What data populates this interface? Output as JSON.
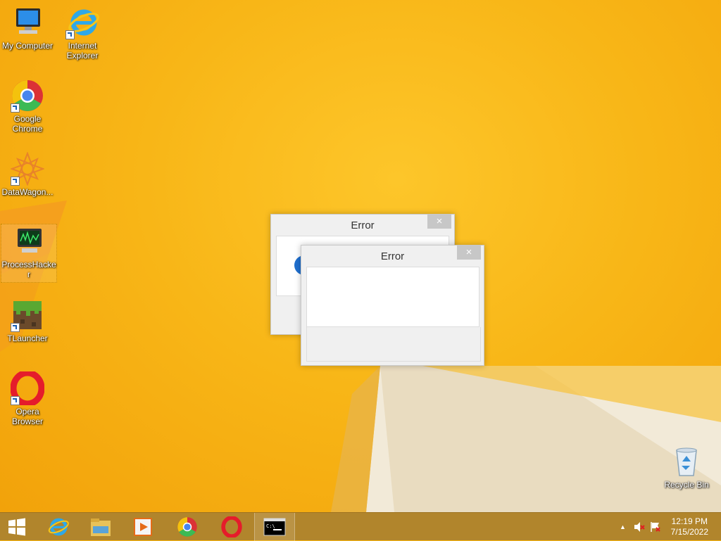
{
  "desktop": {
    "icons": [
      {
        "label": "My Computer",
        "icon": "computer-icon"
      },
      {
        "label": "Internet Explorer",
        "icon": "internet-explorer-icon"
      },
      {
        "label": "Google Chrome",
        "icon": "chrome-icon"
      },
      {
        "label": "DataWagon...",
        "icon": "datawagon-icon"
      },
      {
        "label": "ProcessHacker",
        "icon": "process-hacker-icon"
      },
      {
        "label": "TLauncher",
        "icon": "tlauncher-icon"
      },
      {
        "label": "Opera Browser",
        "icon": "opera-icon"
      },
      {
        "label": "Recycle Bin",
        "icon": "recycle-bin-icon"
      }
    ]
  },
  "dialogs": [
    {
      "title": "Error",
      "close": "×"
    },
    {
      "title": "Error",
      "close": "×"
    }
  ],
  "taskbar": {
    "buttons": [
      "start-icon",
      "internet-explorer-icon",
      "file-explorer-icon",
      "media-player-icon",
      "chrome-icon",
      "opera-icon",
      "cmd-icon"
    ],
    "tray": {
      "show_hidden": "▲",
      "time": "12:19 PM",
      "date": "7/15/2022"
    }
  },
  "colors": {
    "wallpaper": "#f6b50f",
    "taskbar": "#b1852c",
    "dialog_bg": "#f0f0f0",
    "close_btn": "#c7c7c7"
  }
}
